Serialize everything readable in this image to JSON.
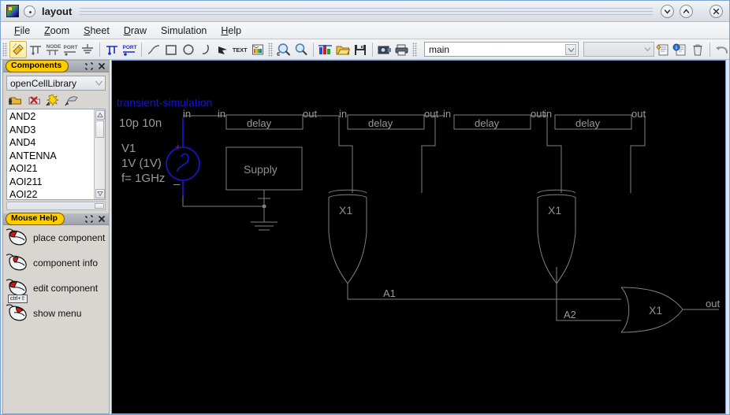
{
  "window": {
    "title": "layout",
    "app_icon": "application-icon",
    "buttons": [
      {
        "name": "shade-down-button",
        "glyph": "chevron-down-icon"
      },
      {
        "name": "shade-up-button",
        "glyph": "chevron-up-icon"
      },
      {
        "name": "close-button",
        "glyph": "close-icon"
      }
    ]
  },
  "menubar": {
    "items": [
      {
        "label": "File",
        "mnemonic": "F"
      },
      {
        "label": "Zoom",
        "mnemonic": "Z"
      },
      {
        "label": "Sheet",
        "mnemonic": "S"
      },
      {
        "label": "Draw",
        "mnemonic": "D"
      },
      {
        "label": "Simulation",
        "mnemonic": ""
      },
      {
        "label": "Help",
        "mnemonic": "H"
      }
    ]
  },
  "toolbar": {
    "groups": [
      {
        "name": "edit-tools",
        "buttons": [
          {
            "name": "select-wand-tool",
            "icon": "magic-wand-icon",
            "active": true
          },
          {
            "name": "insert-wire-tool",
            "icon": "wire-node-icon",
            "active": false
          },
          {
            "name": "insert-node-tool",
            "icon": "node-label-icon",
            "active": false
          },
          {
            "name": "insert-port-tool",
            "icon": "port-label-icon",
            "active": false
          },
          {
            "name": "insert-ground-tool",
            "icon": "ground-icon",
            "active": false
          }
        ]
      },
      {
        "name": "net-tools",
        "buttons": [
          {
            "name": "net-wire-tool",
            "icon": "blue-wire-node-icon",
            "active": false
          },
          {
            "name": "net-port-tool",
            "icon": "blue-port-icon",
            "active": false
          }
        ]
      },
      {
        "name": "draw-tools",
        "buttons": [
          {
            "name": "draw-line-tool",
            "icon": "line-icon",
            "active": false
          },
          {
            "name": "draw-rectangle-tool",
            "icon": "rectangle-icon",
            "active": false
          },
          {
            "name": "draw-circle-tool",
            "icon": "circle-icon",
            "active": false
          },
          {
            "name": "draw-arc-tool",
            "icon": "arc-icon",
            "active": false
          },
          {
            "name": "draw-polygon-tool",
            "icon": "polygon-icon",
            "active": false
          },
          {
            "name": "draw-text-tool",
            "icon": "text-icon",
            "label": "TEXT",
            "active": false
          },
          {
            "name": "draw-image-tool",
            "icon": "image-icon",
            "active": false
          }
        ]
      },
      {
        "name": "view-tools",
        "buttons": [
          {
            "name": "zoom-fit-button",
            "icon": "zoom-fit-icon",
            "active": false
          },
          {
            "name": "zoom-in-button",
            "icon": "magnifier-icon",
            "active": false
          }
        ]
      },
      {
        "name": "file-tools",
        "buttons": [
          {
            "name": "new-schematic-button",
            "icon": "new-schematic-icon",
            "active": false
          },
          {
            "name": "open-file-button",
            "icon": "folder-open-icon",
            "active": false
          },
          {
            "name": "save-file-button",
            "icon": "floppy-save-icon",
            "active": false
          }
        ]
      },
      {
        "name": "output-tools",
        "buttons": [
          {
            "name": "screenshot-button",
            "icon": "camera-icon",
            "active": false
          },
          {
            "name": "print-button",
            "icon": "printer-icon",
            "active": false
          }
        ]
      },
      {
        "name": "sheet-tools",
        "buttons": [
          {
            "name": "new-sheet-button",
            "icon": "new-sheet-icon",
            "active": false
          },
          {
            "name": "sheet-info-button",
            "icon": "sheet-info-icon",
            "active": false
          },
          {
            "name": "delete-sheet-button",
            "icon": "trash-icon",
            "active": false
          }
        ]
      },
      {
        "name": "history-tools",
        "buttons": [
          {
            "name": "undo-button",
            "icon": "undo-icon",
            "active": false
          },
          {
            "name": "redo-button",
            "icon": "redo-icon",
            "active": false
          }
        ]
      }
    ],
    "sheet_selector": {
      "value": "main",
      "name": "sheet-selector"
    },
    "second_selector": {
      "value": "",
      "name": "secondary-selector"
    }
  },
  "components_panel": {
    "title": "Components",
    "library": "openCellLibrary",
    "window_buttons": [
      {
        "name": "components-float-button",
        "glyph": "⬚"
      },
      {
        "name": "components-close-button",
        "glyph": "✕"
      }
    ],
    "tool_icons": [
      {
        "name": "library-open-icon"
      },
      {
        "name": "library-delete-icon"
      },
      {
        "name": "library-new-icon"
      },
      {
        "name": "library-edit-icon"
      }
    ],
    "items": [
      "AND2",
      "AND3",
      "AND4",
      "ANTENNA",
      "AOI21",
      "AOI211",
      "AOI22"
    ]
  },
  "mouse_help_panel": {
    "title": "Mouse Help",
    "window_buttons": [
      {
        "name": "mousehelp-float-button",
        "glyph": "⬚"
      },
      {
        "name": "mousehelp-close-button",
        "glyph": "✕"
      }
    ],
    "rows": [
      {
        "icon": "mouse-left-click-icon",
        "label": "place component",
        "modifier": ""
      },
      {
        "icon": "mouse-middle-click-icon",
        "label": "component info",
        "modifier": ""
      },
      {
        "icon": "mouse-ctrl-shift-click-icon",
        "label": "edit component",
        "modifier": "ctrl+⇧"
      },
      {
        "icon": "mouse-right-click-icon",
        "label": "show menu",
        "modifier": ""
      }
    ]
  },
  "schematic": {
    "title": "transient-simulation",
    "title_color": "#1414d0",
    "wire_color": "#808080",
    "source_color": "#1616e0",
    "plus_color": "#cc2020",
    "background": "#000000",
    "annotations": {
      "sim_params": "10p 10n",
      "source_name": "V1",
      "source_value": "1V (1V)",
      "source_freq": "f= 1GHz",
      "plus": "+",
      "minus": "_"
    },
    "blocks": [
      {
        "name": "delay-block-1",
        "label": "delay",
        "in": "in",
        "out": "out"
      },
      {
        "name": "delay-block-2",
        "label": "delay",
        "in": "in",
        "out": "out"
      },
      {
        "name": "delay-block-3",
        "label": "delay",
        "in": "in",
        "out": "out"
      },
      {
        "name": "delay-block-4",
        "label": "delay",
        "in": "in",
        "out": "out"
      }
    ],
    "supply_block": {
      "name": "supply-block",
      "label": "Supply"
    },
    "gates": [
      {
        "name": "xor-gate-1",
        "label": "X1",
        "type": "xor"
      },
      {
        "name": "xor-gate-2",
        "label": "X1",
        "type": "xor"
      },
      {
        "name": "or-gate-1",
        "label": "X1",
        "type": "or"
      }
    ],
    "net_labels": {
      "in_left": "in",
      "a1": "A1",
      "a2": "A2",
      "out": "out"
    }
  }
}
